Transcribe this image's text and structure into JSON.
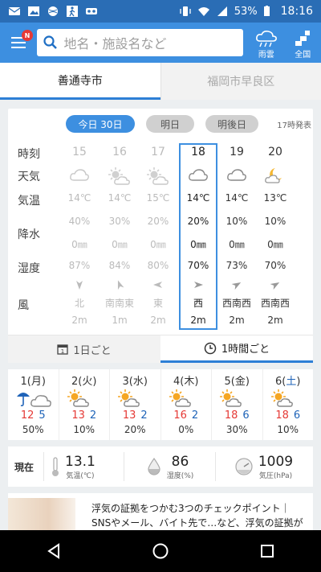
{
  "status": {
    "battery": "53%",
    "time": "18:16"
  },
  "search": {
    "placeholder": "地名・施設名など",
    "badge": "N"
  },
  "topbar": {
    "rain_label": "雨雲",
    "nation_label": "全国"
  },
  "location_tabs": [
    "善通寺市",
    "福岡市早良区"
  ],
  "day_pills": [
    "今日 30日",
    "明日",
    "明後日"
  ],
  "announce": "17時発表",
  "row_labels": {
    "time": "時刻",
    "weather": "天気",
    "temp": "気温",
    "precip": "降水",
    "humidity": "湿度",
    "wind": "風"
  },
  "hourly": [
    {
      "hour": "15",
      "temp": "14℃",
      "pop": "40%",
      "mm": "0㎜",
      "hum": "87%",
      "dir": "北",
      "speed": "2m",
      "state": "past",
      "icon": "cloud-icon"
    },
    {
      "hour": "16",
      "temp": "14℃",
      "pop": "30%",
      "mm": "0㎜",
      "hum": "84%",
      "dir": "南南東",
      "speed": "1m",
      "state": "past",
      "icon": "sun-cloud-icon"
    },
    {
      "hour": "17",
      "temp": "15℃",
      "pop": "20%",
      "mm": "0㎜",
      "hum": "80%",
      "dir": "東",
      "speed": "2m",
      "state": "past",
      "icon": "sun-cloud-icon"
    },
    {
      "hour": "18",
      "temp": "14℃",
      "pop": "20%",
      "mm": "0㎜",
      "hum": "70%",
      "dir": "西",
      "speed": "2m",
      "state": "now",
      "icon": "cloud-icon"
    },
    {
      "hour": "19",
      "temp": "14℃",
      "pop": "10%",
      "mm": "0㎜",
      "hum": "73%",
      "dir": "西南西",
      "speed": "2m",
      "state": "future",
      "icon": "cloud-icon"
    },
    {
      "hour": "20",
      "temp": "13℃",
      "pop": "10%",
      "mm": "0㎜",
      "hum": "70%",
      "dir": "西南西",
      "speed": "2m",
      "state": "future",
      "icon": "moon-cloud-icon"
    }
  ],
  "segment_tabs": [
    "1日ごと",
    "1時間ごと"
  ],
  "weekly": [
    {
      "label": "1(月)",
      "hi": "12",
      "lo": "5",
      "pop": "50%",
      "icon": "rain-cloud-icon"
    },
    {
      "label": "2(火)",
      "hi": "13",
      "lo": "2",
      "pop": "10%",
      "icon": "sun-cloud-icon"
    },
    {
      "label": "3(水)",
      "hi": "13",
      "lo": "2",
      "pop": "20%",
      "icon": "sun-cloud-icon"
    },
    {
      "label": "4(木)",
      "hi": "16",
      "lo": "2",
      "pop": "0%",
      "icon": "sun-cloud-icon"
    },
    {
      "label": "5(金)",
      "hi": "18",
      "lo": "6",
      "pop": "30%",
      "icon": "sun-cloud-icon"
    },
    {
      "label": "6(",
      "label_sat": "土",
      "label_end": ")",
      "hi": "18",
      "lo": "6",
      "pop": "10%",
      "icon": "sun-cloud-icon"
    }
  ],
  "current": {
    "label": "現在",
    "temp_value": "13.1",
    "temp_label": "気温(℃)",
    "hum_value": "86",
    "hum_label": "湿度(%)",
    "press_value": "1009",
    "press_label": "気圧(hPa)"
  },
  "news": {
    "line1": "浮気の証拠をつかむ3つのチェックポイント｜",
    "line2": "SNSやメール、バイト先で…など、浮気の証拠が"
  },
  "colors": {
    "topbar": "#3d8fe0",
    "statusbar": "#2a6db5",
    "accent": "#2d7fd6",
    "hi": "#e53935",
    "lo": "#1e63b8"
  }
}
